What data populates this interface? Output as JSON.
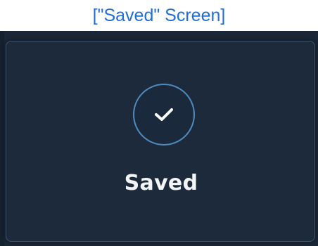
{
  "caption": "[\"Saved\" Screen]",
  "dialog": {
    "icon": "checkmark-icon",
    "label": "Saved"
  },
  "colors": {
    "caption": "#1f6fd6",
    "background": "#1b2736",
    "dialog": "#1c2a3b",
    "accent": "#4f8bbf",
    "text": "#f2f4f7"
  }
}
